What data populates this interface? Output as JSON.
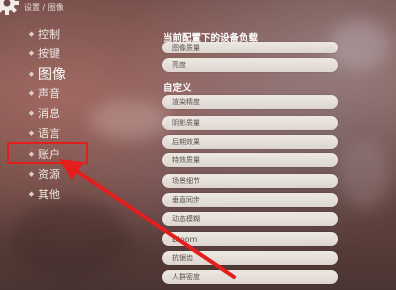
{
  "header": {
    "breadcrumb": "设置 / 图像"
  },
  "sidebar": {
    "items": [
      {
        "label": "控制",
        "active": false
      },
      {
        "label": "按键",
        "active": false
      },
      {
        "label": "图像",
        "active": true
      },
      {
        "label": "声音",
        "active": false
      },
      {
        "label": "消息",
        "active": false
      },
      {
        "label": "语言",
        "active": false
      },
      {
        "label": "账户",
        "active": false
      },
      {
        "label": "资源",
        "active": false
      },
      {
        "label": "其他",
        "active": false
      }
    ]
  },
  "main": {
    "device_section_title": "当前配置下的设备负载",
    "device_items": [
      "图像质量",
      "亮度"
    ],
    "custom_section_title": "自定义",
    "custom_items": [
      "渲染精度",
      "阴影质量",
      "后期效果",
      "特效质量",
      "场景细节",
      "垂直同步",
      "动态模糊",
      "Bloom",
      "抗锯齿",
      "人群密度"
    ]
  },
  "annotation": {
    "box_color": "#e41d1d",
    "arrow_color": "#e41d1d"
  }
}
